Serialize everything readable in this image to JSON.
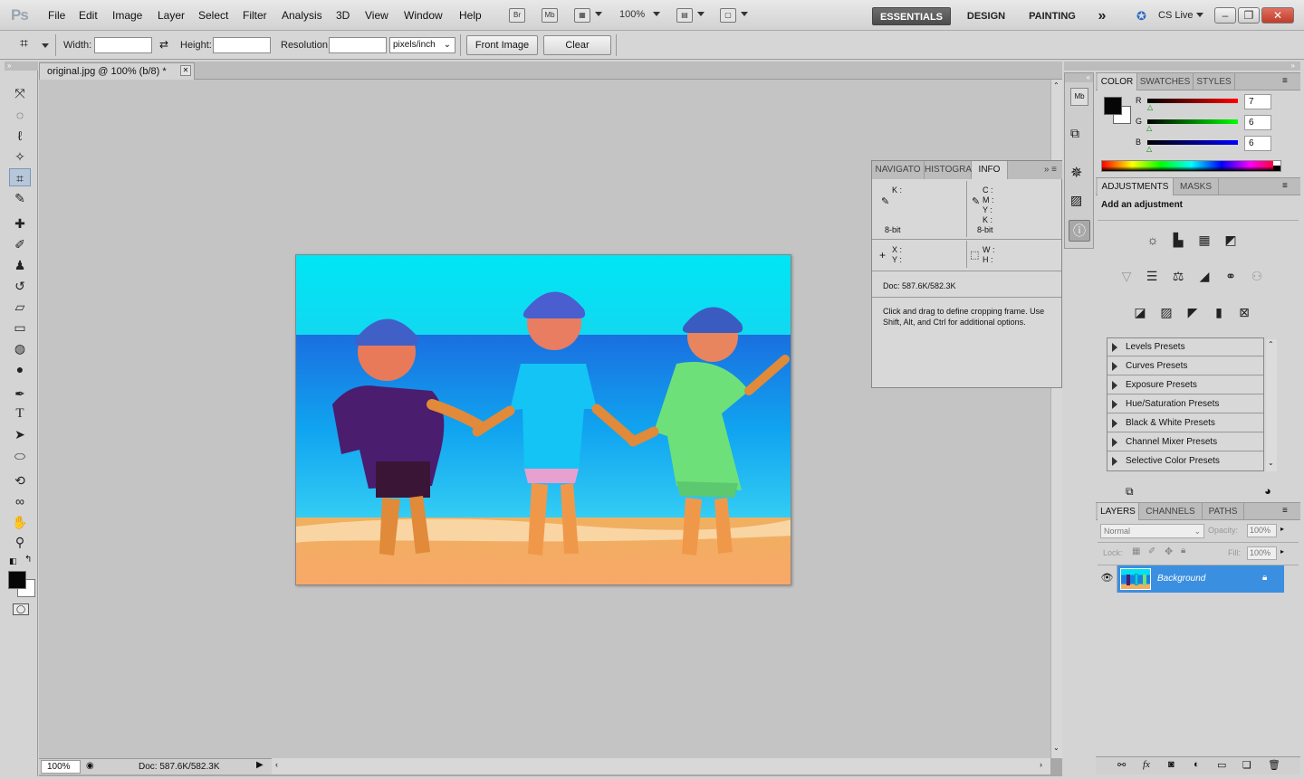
{
  "app": {
    "logo": "Ps"
  },
  "menu": [
    "File",
    "Edit",
    "Image",
    "Layer",
    "Select",
    "Filter",
    "Analysis",
    "3D",
    "View",
    "Window",
    "Help"
  ],
  "apptools": {
    "bridge": "Br",
    "minibridge": "Mb",
    "zoom": "100%"
  },
  "workspaces": {
    "essentials": "ESSENTIALS",
    "design": "DESIGN",
    "painting": "PAINTING",
    "more": "»",
    "cslive": "CS Live"
  },
  "window_controls": {
    "minimize": "–",
    "restore": "❐",
    "close": "✕"
  },
  "options": {
    "width_label": "Width:",
    "width_value": "",
    "height_label": "Height:",
    "height_value": "",
    "resolution_label": "Resolution:",
    "resolution_value": "",
    "unit": "pixels/inch",
    "front_image": "Front Image",
    "clear": "Clear"
  },
  "document": {
    "tab_title": "original.jpg @ 100% (b/8) *",
    "close": "✕"
  },
  "status": {
    "zoom": "100%",
    "doc": "Doc: 587.6K/582.3K"
  },
  "info_panel": {
    "tabs": [
      "NAVIGATO",
      "HISTOGRA",
      "INFO"
    ],
    "k_label": "K :",
    "cmyk_labels": [
      "C :",
      "M :",
      "Y :",
      "K :"
    ],
    "bit_left": "8-bit",
    "bit_right": "8-bit",
    "x_label": "X :",
    "y_label": "Y :",
    "w_label": "W :",
    "h_label": "H :",
    "doc": "Doc: 587.6K/582.3K",
    "hint": "Click and drag to define cropping frame. Use Shift, Alt, and Ctrl for additional options."
  },
  "color_panel": {
    "tabs": [
      "COLOR",
      "SWATCHES",
      "STYLES"
    ],
    "r_label": "R",
    "g_label": "G",
    "b_label": "B",
    "r": "7",
    "g": "6",
    "b": "6",
    "r_level": 0.03,
    "g_level": 0.02,
    "b_level": 0.02
  },
  "adjustments_panel": {
    "tabs": [
      "ADJUSTMENTS",
      "MASKS"
    ],
    "title": "Add an adjustment",
    "presets": [
      "Levels Presets",
      "Curves Presets",
      "Exposure Presets",
      "Hue/Saturation Presets",
      "Black & White Presets",
      "Channel Mixer Presets",
      "Selective Color Presets"
    ]
  },
  "layers_panel": {
    "tabs": [
      "LAYERS",
      "CHANNELS",
      "PATHS"
    ],
    "blend_mode": "Normal",
    "opacity_label": "Opacity:",
    "opacity": "100%",
    "lock_label": "Lock:",
    "fill_label": "Fill:",
    "fill": "100%",
    "layers": [
      {
        "name": "Background"
      }
    ]
  },
  "colors": {
    "accent_selection": "#3b8fe0",
    "foreground": "#070606",
    "background": "#ffffff"
  }
}
